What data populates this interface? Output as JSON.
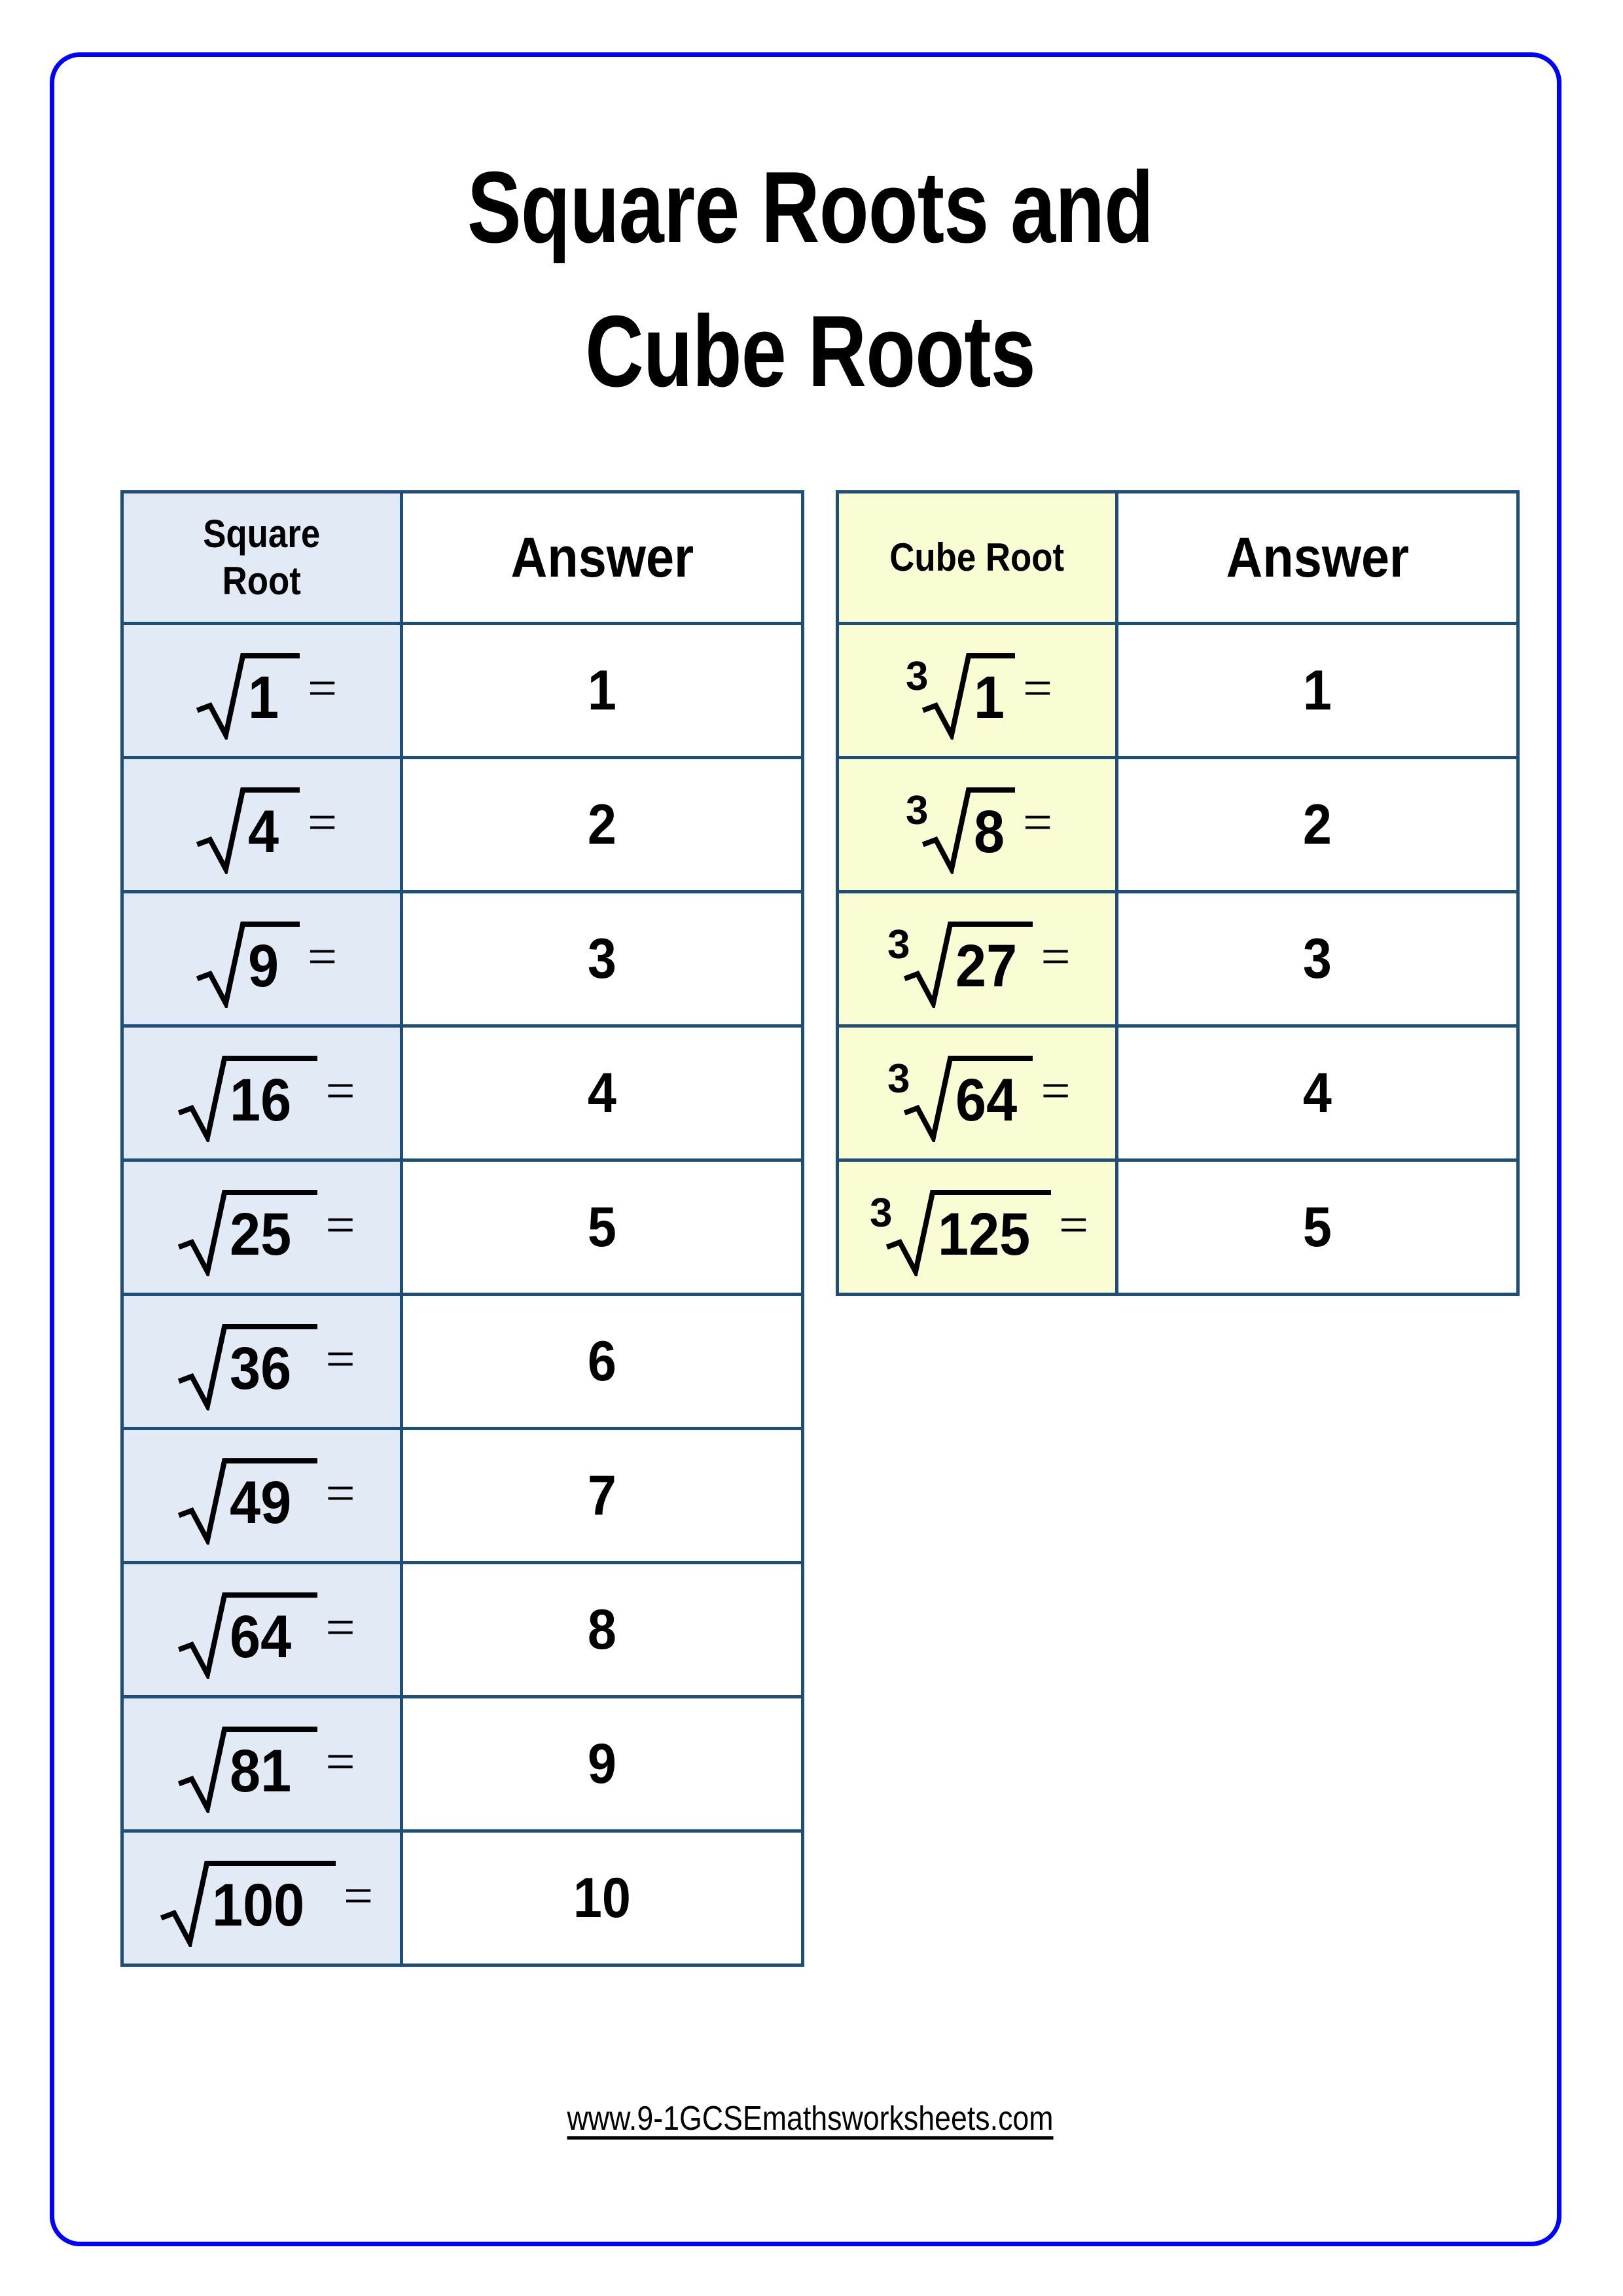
{
  "page": {
    "frame_color": "#0000ff",
    "background": "#ffffff"
  },
  "title": {
    "line1": "Square Roots and",
    "line2": "Cube Roots"
  },
  "square_root_table": {
    "header": {
      "expr_label": "Square\nRoot",
      "answer_label": "Answer"
    },
    "cell_fill": "#e2eaf6",
    "border_color": "#1f4e79",
    "rows": [
      {
        "radicand": "1",
        "index": "",
        "equals": "=",
        "answer": "1"
      },
      {
        "radicand": "4",
        "index": "",
        "equals": "=",
        "answer": "2"
      },
      {
        "radicand": "9",
        "index": "",
        "equals": "=",
        "answer": "3"
      },
      {
        "radicand": "16",
        "index": "",
        "equals": "=",
        "answer": "4"
      },
      {
        "radicand": "25",
        "index": "",
        "equals": "=",
        "answer": "5"
      },
      {
        "radicand": "36",
        "index": "",
        "equals": "=",
        "answer": "6"
      },
      {
        "radicand": "49",
        "index": "",
        "equals": "=",
        "answer": "7"
      },
      {
        "radicand": "64",
        "index": "",
        "equals": "=",
        "answer": "8"
      },
      {
        "radicand": "81",
        "index": "",
        "equals": "=",
        "answer": "9"
      },
      {
        "radicand": "100",
        "index": "",
        "equals": "=",
        "answer": "10"
      }
    ]
  },
  "cube_root_table": {
    "header": {
      "expr_label": "Cube Root",
      "answer_label": "Answer"
    },
    "cell_fill": "#fafcd3",
    "border_color": "#1f4e79",
    "rows": [
      {
        "radicand": "1",
        "index": "3",
        "equals": "=",
        "answer": "1"
      },
      {
        "radicand": "8",
        "index": "3",
        "equals": "=",
        "answer": "2"
      },
      {
        "radicand": "27",
        "index": "3",
        "equals": "=",
        "answer": "3"
      },
      {
        "radicand": "64",
        "index": "3",
        "equals": "=",
        "answer": "4"
      },
      {
        "radicand": "125",
        "index": "3",
        "equals": "=",
        "answer": "5"
      }
    ]
  },
  "footer": {
    "url": "www.9-1GCSEmathsworksheets.com"
  }
}
